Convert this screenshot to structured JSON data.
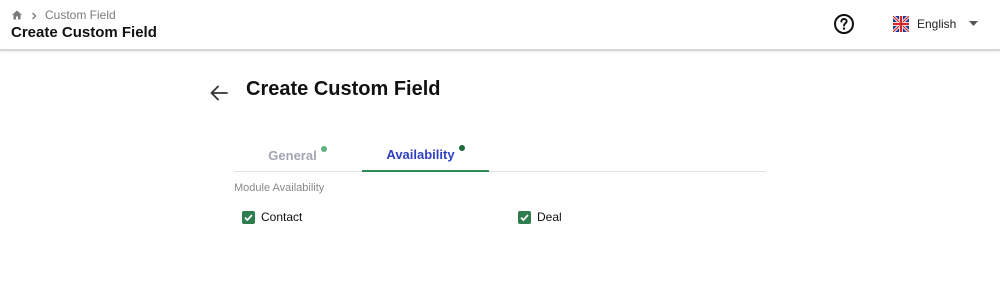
{
  "header": {
    "breadcrumb": {
      "current": "Custom Field"
    },
    "title": "Create Custom Field",
    "language": {
      "selected": "English"
    }
  },
  "main": {
    "title": "Create Custom Field",
    "tabs": [
      {
        "label": "General",
        "active": false,
        "dot_color": "#5fb27e"
      },
      {
        "label": "Availability",
        "active": true,
        "dot_color": "#1e6b3a"
      }
    ],
    "section_label": "Module Availability",
    "modules": [
      {
        "label": "Contact",
        "checked": true
      },
      {
        "label": "Deal",
        "checked": true
      }
    ]
  },
  "colors": {
    "active_tab_text": "#2f3fc3",
    "active_tab_underline": "#2e8b57",
    "checkbox": "#2e7d4f"
  }
}
